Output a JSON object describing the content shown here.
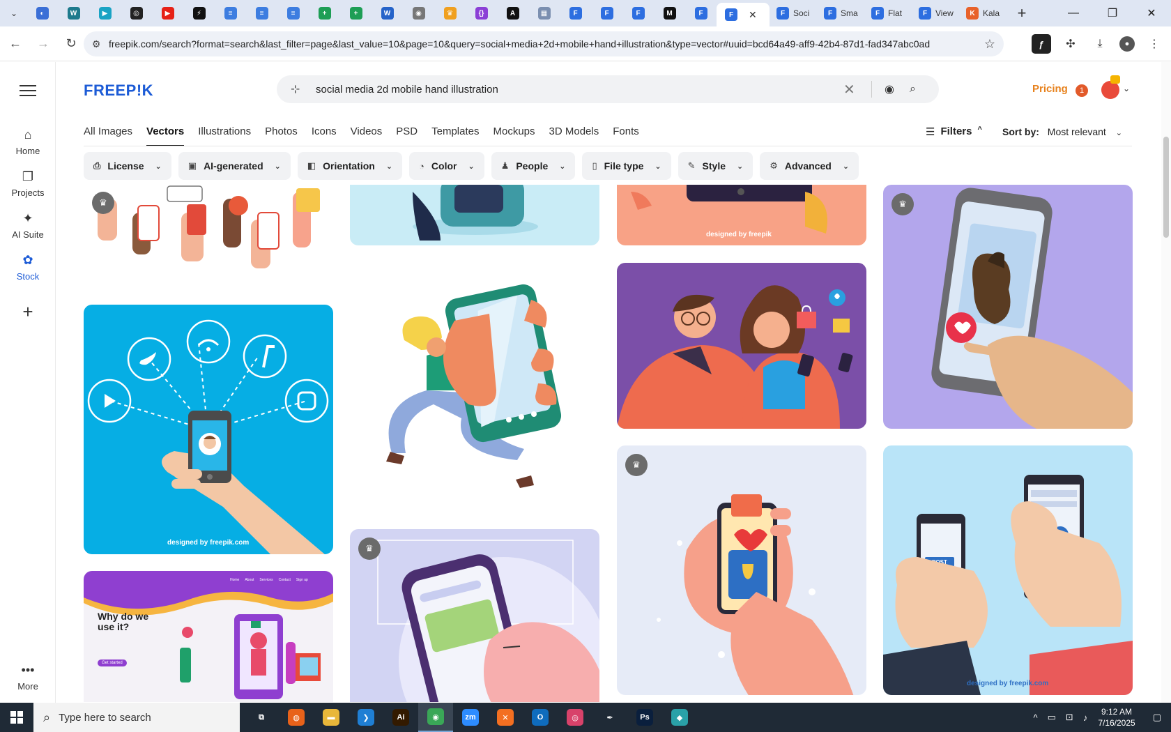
{
  "browser": {
    "tabs_collapsed": [
      {
        "icon": "browser-icon",
        "color": "#3b6fd6",
        "glyph": "◐"
      },
      {
        "icon": "wordpress-icon",
        "color": "#1d7a8c",
        "glyph": "W"
      },
      {
        "icon": "play-icon",
        "color": "#1aa3c4",
        "glyph": "▶"
      },
      {
        "icon": "openai-icon",
        "color": "#222222",
        "glyph": "◎"
      },
      {
        "icon": "youtube-icon",
        "color": "#e62117",
        "glyph": "▶"
      },
      {
        "icon": "bolt-icon",
        "color": "#111111",
        "glyph": "⚡"
      },
      {
        "icon": "docs-icon",
        "color": "#3d7de0",
        "glyph": "≡"
      },
      {
        "icon": "docs-icon",
        "color": "#3d7de0",
        "glyph": "≡"
      },
      {
        "icon": "docs-icon",
        "color": "#3d7de0",
        "glyph": "≡"
      },
      {
        "icon": "sheets-icon",
        "color": "#1e9e55",
        "glyph": "+"
      },
      {
        "icon": "sheets-icon",
        "color": "#1e9e55",
        "glyph": "+"
      },
      {
        "icon": "word-icon",
        "color": "#2563c9",
        "glyph": "W"
      },
      {
        "icon": "globe-icon",
        "color": "#777777",
        "glyph": "◉"
      },
      {
        "icon": "crown-icon",
        "color": "#f0a020",
        "glyph": "♛"
      },
      {
        "icon": "code-icon",
        "color": "#8b3fd6",
        "glyph": "{}"
      },
      {
        "icon": "a-icon",
        "color": "#111111",
        "glyph": "A"
      },
      {
        "icon": "grid-icon",
        "color": "#7b8fb0",
        "glyph": "▦"
      },
      {
        "icon": "flat-icon",
        "color": "#2d6ee0",
        "glyph": "F"
      },
      {
        "icon": "flat-icon",
        "color": "#2d6ee0",
        "glyph": "F"
      },
      {
        "icon": "flat-icon",
        "color": "#2d6ee0",
        "glyph": "F"
      },
      {
        "icon": "m-icon",
        "color": "#111111",
        "glyph": "M"
      },
      {
        "icon": "flat-icon",
        "color": "#2d6ee0",
        "glyph": "F"
      }
    ],
    "tabs_titled": [
      {
        "icon": "flat-icon",
        "title": "Soci"
      },
      {
        "icon": "flat-icon",
        "title": "Sma"
      },
      {
        "icon": "flat-icon",
        "title": "Flat"
      },
      {
        "icon": "flat-icon",
        "title": "View"
      },
      {
        "icon": "kala-icon",
        "title": "Kala"
      }
    ],
    "new_tab_label": "+",
    "url": "freepik.com/search?format=search&last_filter=page&last_value=10&page=10&query=social+media+2d+mobile+hand+illustration&type=vector#uuid=bcd64a49-aff9-42b4-87d1-fad347abc0ad"
  },
  "rail": {
    "items": [
      {
        "label": "Home",
        "icon": "home-icon",
        "glyph": "⌂"
      },
      {
        "label": "Projects",
        "icon": "projects-icon",
        "glyph": "❐"
      },
      {
        "label": "AI Suite",
        "icon": "sparkle-icon",
        "glyph": "✦"
      },
      {
        "label": "Stock",
        "icon": "stock-icon",
        "glyph": "✿"
      }
    ],
    "more_label": "More",
    "more_glyph": "•••"
  },
  "header": {
    "logo": "FREEP!K",
    "search_value": "social media 2d mobile hand illustration",
    "pricing": "Pricing",
    "notification_count": "1"
  },
  "type_tabs": [
    "All Images",
    "Vectors",
    "Illustrations",
    "Photos",
    "Icons",
    "Videos",
    "PSD",
    "Templates",
    "Mockups",
    "3D Models",
    "Fonts"
  ],
  "active_type_tab": "Vectors",
  "filters_label": "Filters",
  "sort": {
    "label": "Sort by:",
    "value": "Most relevant"
  },
  "pills": [
    {
      "label": "License",
      "icon": "license-icon",
      "glyph": "⎙"
    },
    {
      "label": "AI-generated",
      "icon": "ai-icon",
      "glyph": "▣"
    },
    {
      "label": "Orientation",
      "icon": "orientation-icon",
      "glyph": "◧"
    },
    {
      "label": "Color",
      "icon": "palette-icon",
      "glyph": "◔"
    },
    {
      "label": "People",
      "icon": "people-icon",
      "glyph": "♟"
    },
    {
      "label": "File type",
      "icon": "file-icon",
      "glyph": "▯"
    },
    {
      "label": "Style",
      "icon": "brush-icon",
      "glyph": "✎"
    },
    {
      "label": "Advanced",
      "icon": "gear-icon",
      "glyph": "⚙"
    }
  ],
  "cards": {
    "credit_freepik": "designed by freepik",
    "credit_freepik_com": "designed by freepik.com",
    "landing_title": "Why do we use it?",
    "landing_cta": "Get started",
    "landing_nav": [
      "Home",
      "About",
      "Services",
      "Contact",
      "Sign up"
    ],
    "post_label": "POST"
  },
  "taskbar": {
    "search_placeholder": "Type here to search",
    "apps": [
      {
        "icon": "task-view-icon",
        "color": "#1f2a36",
        "glyph": "⧉"
      },
      {
        "icon": "firefox-icon",
        "color": "#e8621a",
        "glyph": "◍"
      },
      {
        "icon": "explorer-icon",
        "color": "#e8b73a",
        "glyph": "▬"
      },
      {
        "icon": "vscode-icon",
        "color": "#1f7fd4",
        "glyph": "❯"
      },
      {
        "icon": "illustrator-icon",
        "color": "#331a00",
        "glyph": "Ai"
      },
      {
        "icon": "chrome-icon",
        "color": "#3aa757",
        "glyph": "◉"
      },
      {
        "icon": "zoom-icon",
        "color": "#2d8cff",
        "glyph": "zm"
      },
      {
        "icon": "xampp-icon",
        "color": "#f36f21",
        "glyph": "✕"
      },
      {
        "icon": "outlook-icon",
        "color": "#0f6cbd",
        "glyph": "O"
      },
      {
        "icon": "cc-icon",
        "color": "#d8426a",
        "glyph": "◎"
      },
      {
        "icon": "pen-icon",
        "color": "#1f2a36",
        "glyph": "✒"
      },
      {
        "icon": "photoshop-icon",
        "color": "#0a1f3d",
        "glyph": "Ps"
      },
      {
        "icon": "gem-icon",
        "color": "#2aa1a8",
        "glyph": "◆"
      }
    ],
    "time": "9:12 AM",
    "date": "7/16/2025"
  }
}
